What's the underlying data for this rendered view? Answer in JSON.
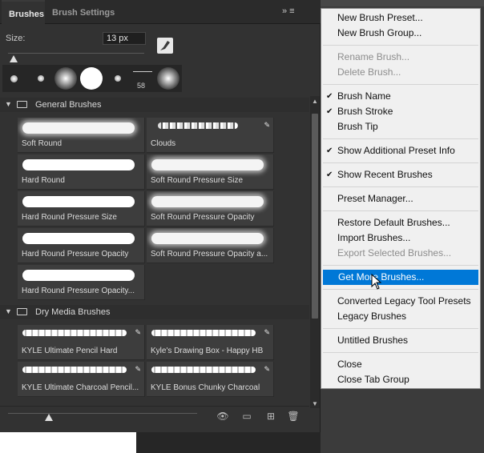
{
  "panel": {
    "tabs": {
      "brushes": "Brushes",
      "brush_settings": "Brush Settings"
    },
    "menu_icons": "» ≡",
    "size": {
      "label": "Size:",
      "value": "13 px"
    },
    "recent_count": "58",
    "groups": [
      {
        "name": "General Brushes"
      },
      {
        "name": "Dry Media Brushes"
      }
    ],
    "general_brushes": [
      "Soft Round",
      "Clouds",
      "Hard Round",
      "Soft Round Pressure Size",
      "Hard Round Pressure Size",
      "Soft Round Pressure Opacity",
      "Hard Round Pressure Opacity",
      "Soft Round Pressure Opacity a...",
      "Hard Round Pressure Opacity..."
    ],
    "dry_media_brushes": [
      "KYLE Ultimate Pencil Hard",
      "Kyle's Drawing Box - Happy HB",
      "KYLE Ultimate Charcoal Pencil...",
      "KYLE Bonus Chunky Charcoal"
    ]
  },
  "menu": {
    "items": [
      {
        "label": "New Brush Preset...",
        "state": "normal"
      },
      {
        "label": "New Brush Group...",
        "state": "normal"
      },
      {
        "label": "Rename Brush...",
        "state": "disabled"
      },
      {
        "label": "Delete Brush...",
        "state": "disabled"
      },
      {
        "label": "Brush Name",
        "state": "checked"
      },
      {
        "label": "Brush Stroke",
        "state": "checked"
      },
      {
        "label": "Brush Tip",
        "state": "normal"
      },
      {
        "label": "Show Additional Preset Info",
        "state": "checked"
      },
      {
        "label": "Show Recent Brushes",
        "state": "checked"
      },
      {
        "label": "Preset Manager...",
        "state": "normal"
      },
      {
        "label": "Restore Default Brushes...",
        "state": "normal"
      },
      {
        "label": "Import Brushes...",
        "state": "normal"
      },
      {
        "label": "Export Selected Brushes...",
        "state": "disabled"
      },
      {
        "label": "Get More Brushes...",
        "state": "highlighted"
      },
      {
        "label": "Converted Legacy Tool Presets",
        "state": "normal"
      },
      {
        "label": "Legacy Brushes",
        "state": "normal"
      },
      {
        "label": "Untitled Brushes",
        "state": "normal"
      },
      {
        "label": "Close",
        "state": "normal"
      },
      {
        "label": "Close Tab Group",
        "state": "normal"
      }
    ]
  },
  "colors": {
    "highlight": "#0078d7",
    "panel_bg": "#323232",
    "menu_bg": "#f0f0f0"
  },
  "icons": [
    "chevron-down-icon",
    "folder-icon",
    "brush-tip-icon",
    "checkmark-icon",
    "new-folder-icon",
    "new-brush-icon",
    "trash-icon",
    "eye-icon",
    "mouse-cursor-icon"
  ]
}
